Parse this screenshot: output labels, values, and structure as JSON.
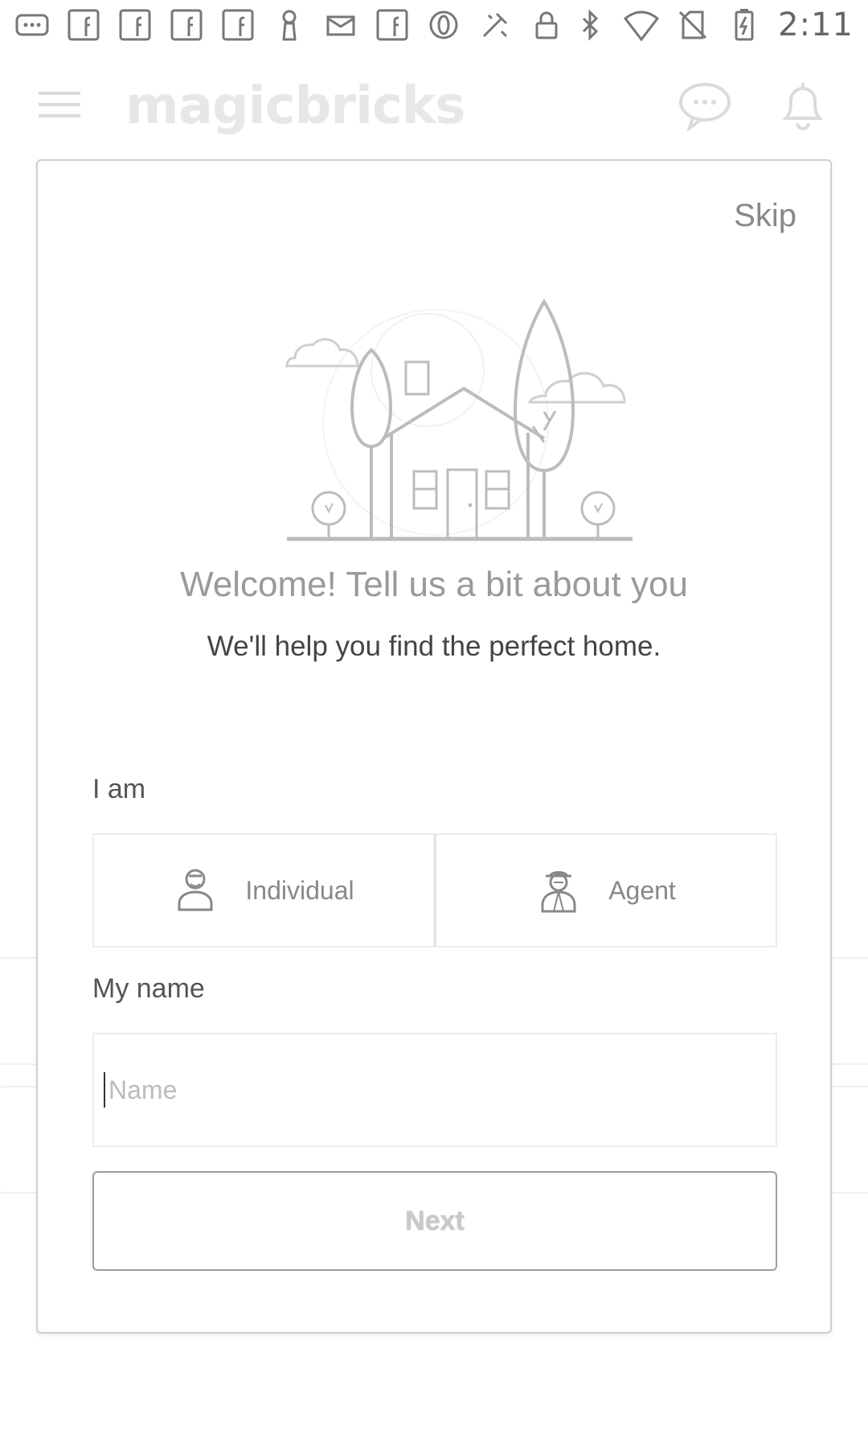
{
  "status_bar": {
    "time": "2:11",
    "left_icons": [
      "more-icon",
      "facebook-icon",
      "facebook-icon",
      "facebook-icon",
      "facebook-icon",
      "person-icon",
      "mail-icon",
      "facebook-icon",
      "opera-icon",
      "dev-tool-icon",
      "lock-icon"
    ],
    "right_icons": [
      "bluetooth-icon",
      "wifi-icon",
      "no-sim-icon",
      "battery-charging-icon"
    ]
  },
  "app_bar": {
    "brand": "magicbricks"
  },
  "modal": {
    "skip_label": "Skip",
    "welcome_title": "Welcome! Tell us a bit about you",
    "subtitle": "We'll help you find the perfect home.",
    "i_am_label": "I am",
    "choices": [
      {
        "label": "Individual",
        "icon": "individual-icon"
      },
      {
        "label": "Agent",
        "icon": "agent-icon"
      }
    ],
    "my_name_label": "My name",
    "name_placeholder": "Name",
    "name_value": "",
    "next_label": "Next"
  },
  "colors": {
    "text_muted": "#9a9a9a",
    "border": "#cfcfcf",
    "button_border": "#9e9e9e"
  }
}
